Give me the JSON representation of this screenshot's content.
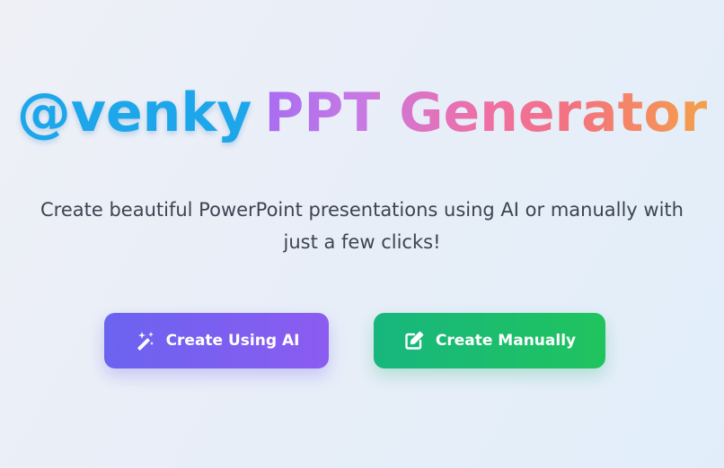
{
  "header": {
    "brand": "@venky",
    "title_ppt": "PPT",
    "title_generator": "Generator"
  },
  "intro": {
    "line1": "Create beautiful PowerPoint presentations using AI or manually with",
    "line2": "just a few clicks!"
  },
  "actions": {
    "ai": {
      "label": "Create Using AI",
      "icon": "magic-wand-icon"
    },
    "manual": {
      "label": "Create Manually",
      "icon": "edit-icon"
    }
  },
  "colors": {
    "brand": "#1ea6ea",
    "ai_button": "#7b5ff0",
    "manual_button": "#1dbd6c",
    "gradient": [
      "#a86df2",
      "#ee6fa8",
      "#f4a049"
    ]
  }
}
